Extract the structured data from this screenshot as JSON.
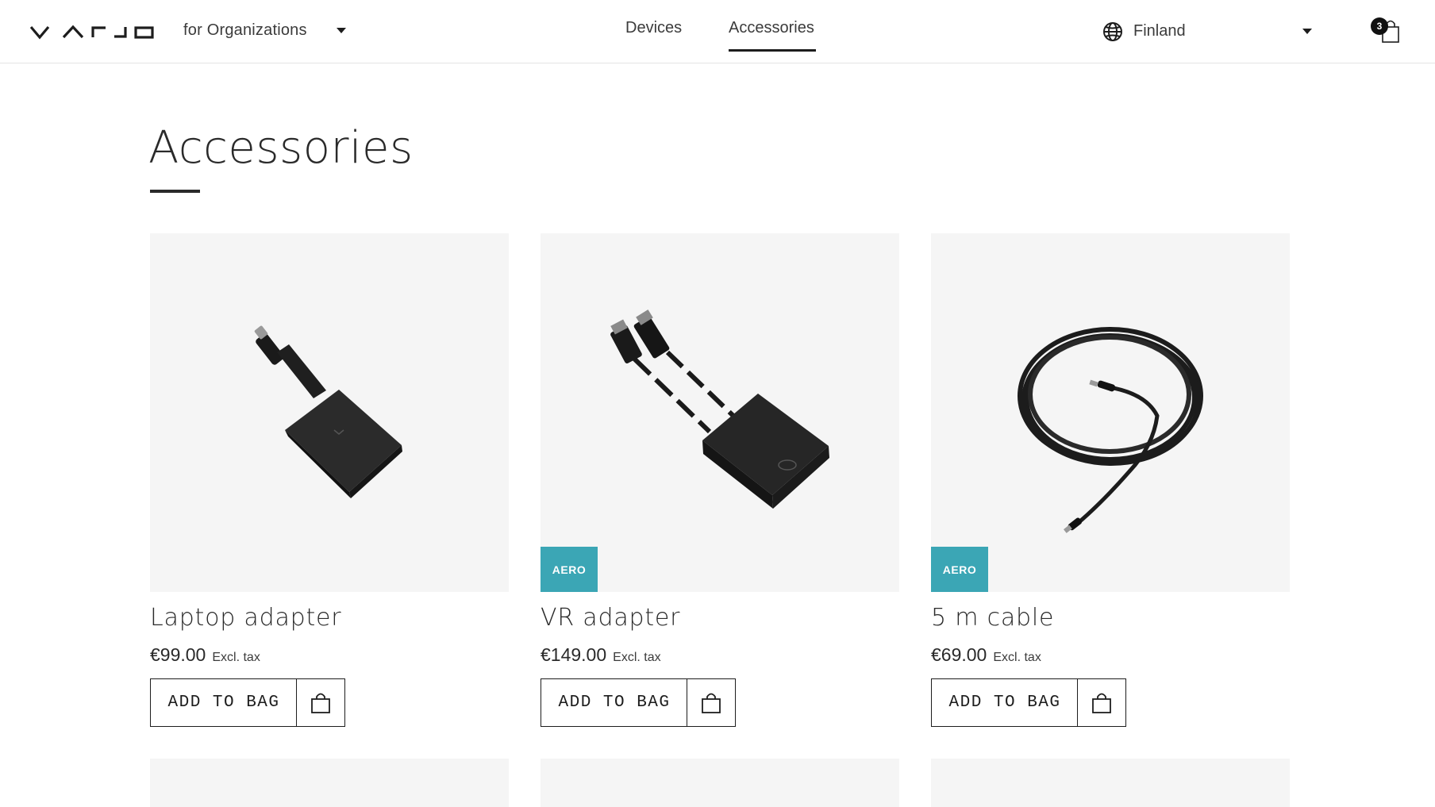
{
  "header": {
    "logo_icon": "varjo-logo",
    "org_selector": {
      "label": "for Organizations",
      "icon": "caret-down-icon"
    },
    "nav": [
      {
        "label": "Devices",
        "active": false
      },
      {
        "label": "Accessories",
        "active": true
      }
    ],
    "country_selector": {
      "label": "Finland",
      "icon": "globe-icon"
    },
    "cart": {
      "count": "3",
      "icon": "shopping-bag-icon"
    }
  },
  "page": {
    "title": "Accessories"
  },
  "products": [
    {
      "name": "Laptop adapter",
      "price": "€99.00",
      "tax_note": "Excl. tax",
      "badge": "",
      "button_label": "ADD TO BAG"
    },
    {
      "name": "VR adapter",
      "price": "€149.00",
      "tax_note": "Excl. tax",
      "badge": "AERO",
      "button_label": "ADD TO BAG"
    },
    {
      "name": "5 m cable",
      "price": "€69.00",
      "tax_note": "Excl. tax",
      "badge": "AERO",
      "button_label": "ADD TO BAG"
    }
  ],
  "colors": {
    "accent_badge": "#3ba6b5",
    "card_background": "#f5f5f5",
    "text": "#2a2a2a"
  }
}
